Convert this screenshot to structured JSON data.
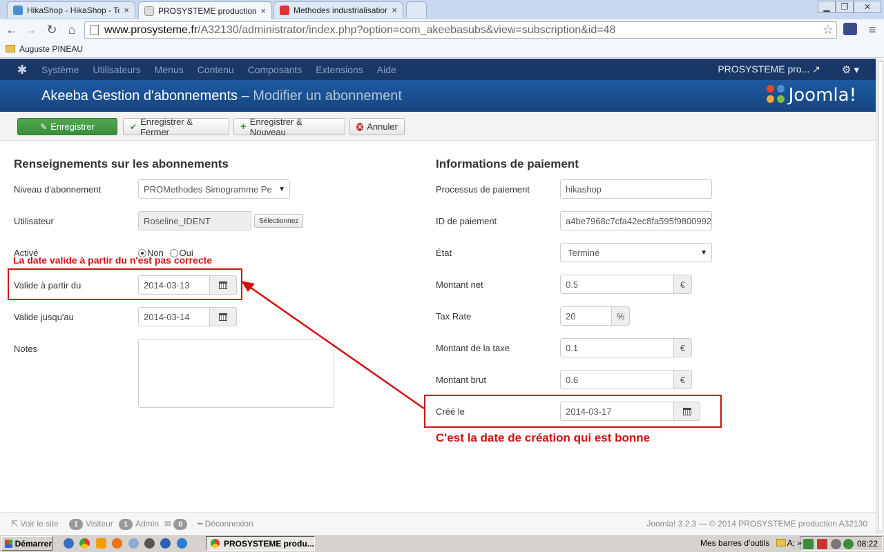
{
  "browser": {
    "tabs": [
      {
        "title": "HikaShop - HikaShop - Topic",
        "close": "×"
      },
      {
        "title": "PROSYSTEME production A",
        "close": "×"
      },
      {
        "title": "Methodes industrialisation, Ar",
        "close": "×"
      }
    ],
    "window_buttons": {
      "minimize": "▁",
      "restore": "❐",
      "close": "✕"
    },
    "nav": {
      "back": "←",
      "forward": "→",
      "reload": "↻",
      "home": "⌂"
    },
    "url": {
      "domain": "www.prosysteme.fr",
      "path": "/A32130/administrator/index.php?option=com_akeebasubs&view=subscription&id=48"
    },
    "star": "☆",
    "menu": "≡",
    "bookmark": "Auguste PINEAU"
  },
  "joomla": {
    "menu": [
      "Système",
      "Utilisateurs",
      "Menus",
      "Contenu",
      "Composants",
      "Extensions",
      "Aide"
    ],
    "site_name": "PROSYSTEME pro...",
    "external_icon": "↗",
    "gear": "⚙ ▾",
    "title_main": "Akeeba Gestion d'abonnements – ",
    "title_sub": "Modifier un abonnement",
    "brand": "Joomla!",
    "toolbar": {
      "save": "Enregistrer",
      "save_close": "Enregistrer & Fermer",
      "save_new": "Enregistrer & Nouveau",
      "cancel": "Annuler"
    }
  },
  "form": {
    "left": {
      "heading": "Renseignements sur les abonnements",
      "level_label": "Niveau d'abonnement",
      "level_value": "PROMethodes Simogramme Pe",
      "user_label": "Utilisateur",
      "user_value": "Roseline_IDENT",
      "select_button": "Sélectionnez",
      "active_label": "Activé",
      "active_no": "Non",
      "active_yes": "Oui",
      "active_value": "Non",
      "valid_from_label": "Valide à partir du",
      "valid_from_value": "2014-03-13",
      "valid_to_label": "Valide jusqu'au",
      "valid_to_value": "2014-03-14",
      "notes_label": "Notes",
      "notes_value": ""
    },
    "right": {
      "heading": "Informations de paiement",
      "processor_label": "Processus de paiement",
      "processor_value": "hikashop",
      "payment_id_label": "ID de paiement",
      "payment_id_value": "a4be7968c7cfa42ec8fa595f9800992",
      "state_label": "État",
      "state_value": "Terminé",
      "net_label": "Montant net",
      "net_value": "0.5",
      "net_unit": "€",
      "tax_rate_label": "Tax Rate",
      "tax_rate_value": "20",
      "tax_rate_unit": "%",
      "tax_amount_label": "Montant de la taxe",
      "tax_amount_value": "0.1",
      "tax_amount_unit": "€",
      "gross_label": "Montant brut",
      "gross_value": "0.6",
      "gross_unit": "€",
      "created_label": "Créé le",
      "created_value": "2014-03-17"
    }
  },
  "annotations": {
    "wrong_date": "La date valide à partir du n'est pas correcte",
    "correct_date": "C'est la date de création qui est bonne",
    "color": "#d01010"
  },
  "footer": {
    "view_site": "Voir le site",
    "visitors_count": "1",
    "visitors_label": "Visiteur",
    "admins_count": "1",
    "admins_label": "Admin",
    "messages_count": "0",
    "logout": "Déconnexion",
    "version": "Joomla! 3.2.3  —  © 2014 PROSYSTEME production A32130"
  },
  "taskbar": {
    "start": "Démarrer",
    "task": "PROSYSTEME produ...",
    "toolbars": "Mes barres d'outils",
    "folder_label": "A;",
    "chevron": "»",
    "clock": "08:22"
  },
  "colors": {
    "joomla_nav": "#1a3867",
    "joomla_title": "#1d5aa3",
    "save_green": "#46a046"
  }
}
